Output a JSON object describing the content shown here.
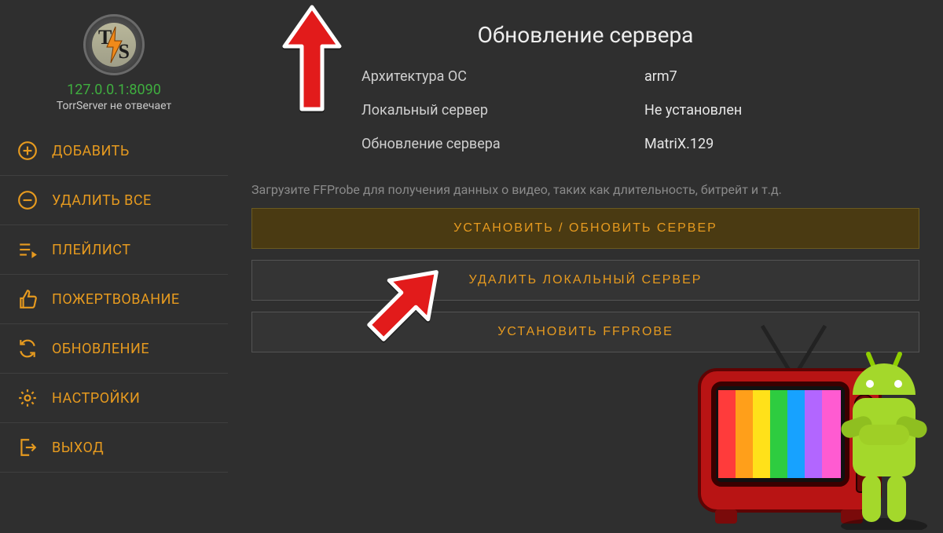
{
  "sidebar": {
    "server_addr": "127.0.0.1:8090",
    "server_status": "TorrServer не отвечает",
    "items": [
      {
        "label": "ДОБАВИТЬ"
      },
      {
        "label": "УДАЛИТЬ ВСЕ"
      },
      {
        "label": "ПЛЕЙЛИСТ"
      },
      {
        "label": "ПОЖЕРТВОВАНИЕ"
      },
      {
        "label": "ОБНОВЛЕНИЕ"
      },
      {
        "label": "НАСТРОЙКИ"
      },
      {
        "label": "ВЫХОД"
      }
    ]
  },
  "main": {
    "title": "Обновление сервера",
    "rows": {
      "arch_label": "Архитектура ОС",
      "arch_value": "arm7",
      "local_label": "Локальный сервер",
      "local_value": "Не установлен",
      "update_label": "Обновление сервера",
      "update_value": "MatriX.129"
    },
    "hint": "Загрузите FFProbe для получения данных о видео, таких как длительность, битрейт и т.д.",
    "buttons": {
      "install_update": "УСТАНОВИТЬ / ОБНОВИТЬ СЕРВЕР",
      "delete_local": "УДАЛИТЬ ЛОКАЛЬНЫЙ СЕРВЕР",
      "install_ffprobe": "УСТАНОВИТЬ FFPROBE"
    }
  }
}
